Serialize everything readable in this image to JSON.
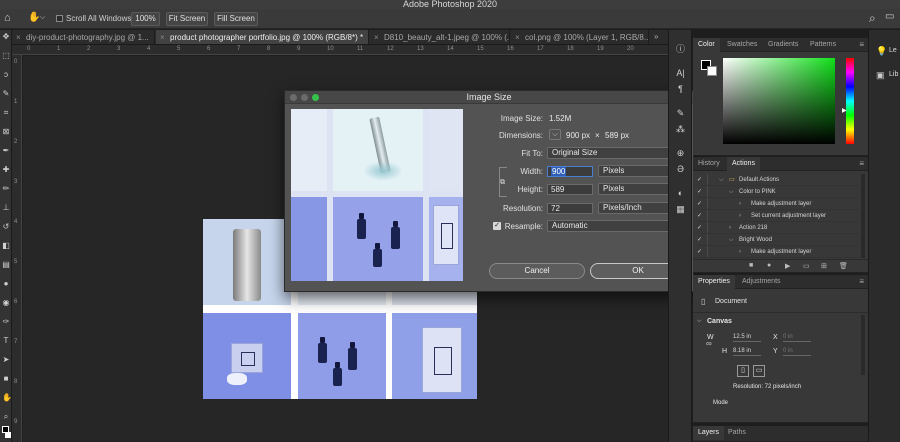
{
  "app": {
    "title": "Adobe Photoshop 2020"
  },
  "options_bar": {
    "scroll_all_windows_label": "Scroll All Windows",
    "zoom_100_label": "100%",
    "fit_screen_label": "Fit Screen",
    "fill_screen_label": "Fill Screen"
  },
  "doc_tabs": [
    {
      "label": "diy-product-photography.jpg @ 1..."
    },
    {
      "label": "product photographer portfolio.jpg @ 100% (RGB/8*) *"
    },
    {
      "label": "D810_beauty_alt-1.jpeg @ 100% (..."
    },
    {
      "label": "col.png @ 100% (Layer 1, RGB/8..."
    }
  ],
  "rulers": {
    "top": [
      "0",
      "1",
      "2",
      "3",
      "4",
      "5",
      "6",
      "7",
      "8",
      "9",
      "10",
      "11",
      "12",
      "13",
      "14",
      "15",
      "16",
      "17",
      "18",
      "19",
      "20"
    ],
    "left": [
      "0",
      "1",
      "2",
      "3",
      "4",
      "5",
      "6",
      "7",
      "8",
      "9"
    ]
  },
  "image_size_dialog": {
    "title": "Image Size",
    "image_size_label": "Image Size:",
    "image_size_value": "1.52M",
    "dimensions_label": "Dimensions:",
    "dimensions_width": "900 px",
    "dimensions_x": "×",
    "dimensions_height": "589 px",
    "fit_to_label": "Fit To:",
    "fit_to_value": "Original Size",
    "width_label": "Width:",
    "width_value": "900",
    "width_unit": "Pixels",
    "height_label": "Height:",
    "height_value": "589",
    "height_unit": "Pixels",
    "resolution_label": "Resolution:",
    "resolution_value": "72",
    "resolution_unit": "Pixels/Inch",
    "resample_label": "Resample:",
    "resample_value": "Automatic",
    "cancel_label": "Cancel",
    "ok_label": "OK"
  },
  "color_panel": {
    "tabs": [
      "Color",
      "Swatches",
      "Gradients",
      "Patterns"
    ],
    "hue_color": "#11e01a"
  },
  "actions_panel": {
    "tabs": [
      "History",
      "Actions"
    ],
    "rows": [
      {
        "label": "Default Actions",
        "indent": 0,
        "expanded": true
      },
      {
        "label": "Color to PINK",
        "indent": 1,
        "expanded": true
      },
      {
        "label": "Make adjustment layer",
        "indent": 2,
        "expanded": false
      },
      {
        "label": "Set current adjustment layer",
        "indent": 2,
        "expanded": false
      },
      {
        "label": "Action 218",
        "indent": 1,
        "expanded": false
      },
      {
        "label": "Bright Wood",
        "indent": 1,
        "expanded": true
      },
      {
        "label": "Make adjustment layer",
        "indent": 2,
        "expanded": false
      }
    ]
  },
  "properties_panel": {
    "tabs": [
      "Properties",
      "Adjustments"
    ],
    "document_label": "Document",
    "canvas_label": "Canvas",
    "w_label": "W",
    "w_value": "12.5 in",
    "h_label": "H",
    "h_value": "8.18 in",
    "x_label": "X",
    "x_value": "0 in",
    "y_label": "Y",
    "y_value": "0 in",
    "resolution_text": "Resolution: 72 pixels/inch",
    "mode_label": "Mode"
  },
  "layers_panel": {
    "tabs": [
      "Layers",
      "Paths"
    ]
  },
  "far_right": {
    "item1": "Le",
    "item2": "Lib"
  }
}
